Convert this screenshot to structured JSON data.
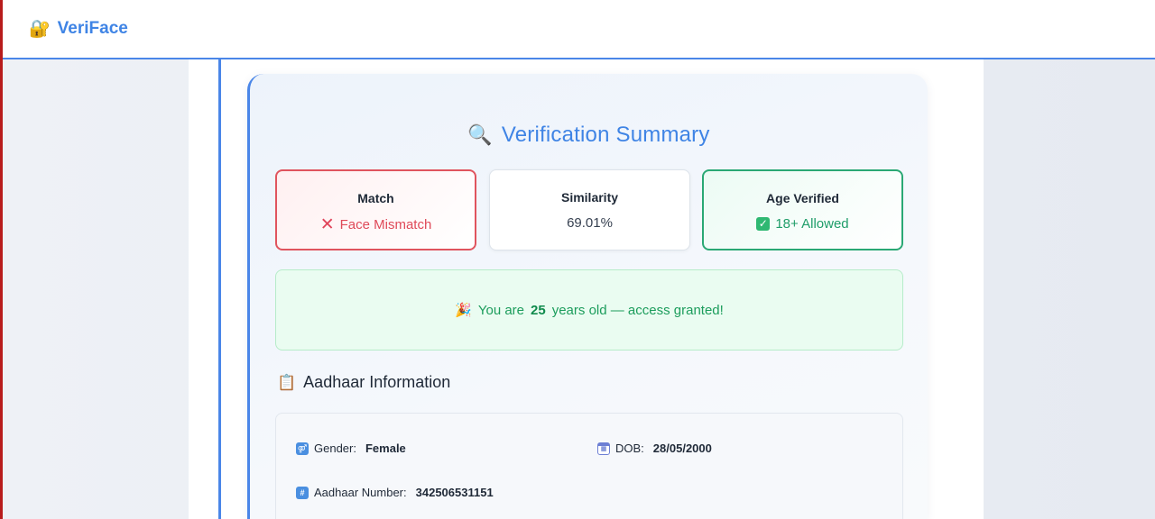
{
  "navbar": {
    "brand_icon": "🔐",
    "brand_icon_name": "lock-with-key-icon",
    "brand_name": "VeriFace"
  },
  "summary": {
    "title_icon": "🔍",
    "title": "Verification Summary",
    "stats": [
      {
        "label": "Match",
        "icon": "✕",
        "icon_name": "cross-mark-icon",
        "value": "Face Mismatch",
        "status": "fail",
        "color": "#df4a59"
      },
      {
        "label": "Similarity",
        "value": "69.01%",
        "status": "neutral"
      },
      {
        "label": "Age Verified",
        "icon": "✓",
        "icon_name": "check-box-icon",
        "value": "18+ Allowed",
        "status": "pass",
        "color": "#1f9d69"
      }
    ]
  },
  "banner": {
    "icon": "🎉",
    "icon_name": "party-popper-icon",
    "prefix": "You are",
    "age": "25",
    "suffix": "years old — access granted!"
  },
  "aadhaar": {
    "section_icon": "📋",
    "section_title": "Aadhaar Information",
    "fields": {
      "gender": {
        "icon": "🚻",
        "label": "Gender:",
        "value": "Female"
      },
      "dob": {
        "icon": "📅",
        "label": "DOB:",
        "value": "28/05/2000"
      },
      "number": {
        "icon": "🔢",
        "label": "Aadhaar Number:",
        "value": "342506531151"
      }
    }
  },
  "colors": {
    "brand": "#3f84e5",
    "accent": "#4a86e8",
    "error": "#e0545e",
    "success": "#2aa874"
  }
}
